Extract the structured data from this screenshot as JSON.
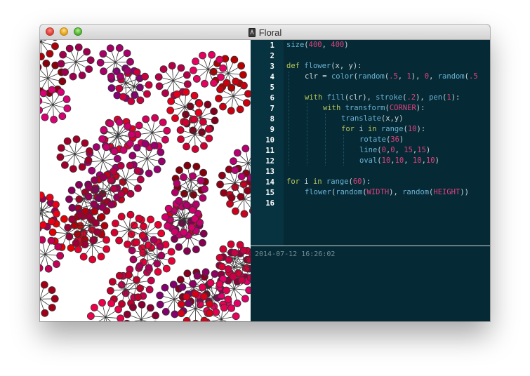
{
  "window": {
    "title": "Floral"
  },
  "editor": {
    "line_numbers": [
      "1",
      "2",
      "3",
      "4",
      "5",
      "6",
      "7",
      "8",
      "9",
      "10",
      "11",
      "12",
      "13",
      "14",
      "15",
      "16"
    ]
  },
  "code": {
    "l1": {
      "fn": "size",
      "a": "(",
      "n1": "400",
      "b": ", ",
      "n2": "400",
      "c": ")"
    },
    "l3": {
      "kw": "def ",
      "fn": "flower",
      "rest": "(x, y):"
    },
    "l4": {
      "pre": "clr = ",
      "fn1": "color",
      "p1": "(",
      "fn2": "random",
      "p2": "(",
      "n1": ".5",
      "p3": ", ",
      "n2": "1",
      "p4": "), ",
      "n3": "0",
      "p5": ", ",
      "fn3": "random",
      "p6": "(",
      "n4": ".5"
    },
    "l6": {
      "kw": "with ",
      "fn1": "fill",
      "p1": "(clr), ",
      "fn2": "stroke",
      "p2": "(",
      "n1": ".2",
      "p3": "), ",
      "fn3": "pen",
      "p4": "(",
      "n2": "1",
      "p5": "):"
    },
    "l7": {
      "kw": "with ",
      "fn": "transform",
      "p1": "(",
      "cst": "CORNER",
      "p2": "):"
    },
    "l8": {
      "fn": "translate",
      "rest": "(x,y)"
    },
    "l9": {
      "kw1": "for ",
      "v": "i ",
      "kw2": "in ",
      "fn": "range",
      "p1": "(",
      "n": "10",
      "p2": "):"
    },
    "l10": {
      "fn": "rotate",
      "p1": "(",
      "n": "36",
      "p2": ")"
    },
    "l11": {
      "fn": "line",
      "p1": "(",
      "n1": "0",
      "c1": ",",
      "n2": "0",
      "c2": ", ",
      "n3": "15",
      "c3": ",",
      "n4": "15",
      "p2": ")"
    },
    "l12": {
      "fn": "oval",
      "p1": "(",
      "n1": "10",
      "c1": ",",
      "n2": "10",
      "c2": ", ",
      "n3": "10",
      "c3": ",",
      "n4": "10",
      "p2": ")"
    },
    "l14": {
      "kw1": "for ",
      "v": "i ",
      "kw2": "in ",
      "fn": "range",
      "p1": "(",
      "n": "60",
      "p2": "):"
    },
    "l15": {
      "fn1": "flower",
      "p1": "(",
      "fn2": "random",
      "p2": "(",
      "c1": "WIDTH",
      "p3": "), ",
      "fn3": "random",
      "p4": "(",
      "c2": "HEIGHT",
      "p5": "))"
    }
  },
  "console": {
    "timestamp": "2014-07-12 16:26:02"
  },
  "colors": {
    "editor_bg": "#052a35",
    "gutter_bg": "#073240",
    "keyword": "#b7c65a",
    "function": "#6cb2d3",
    "number": "#e0407e"
  }
}
